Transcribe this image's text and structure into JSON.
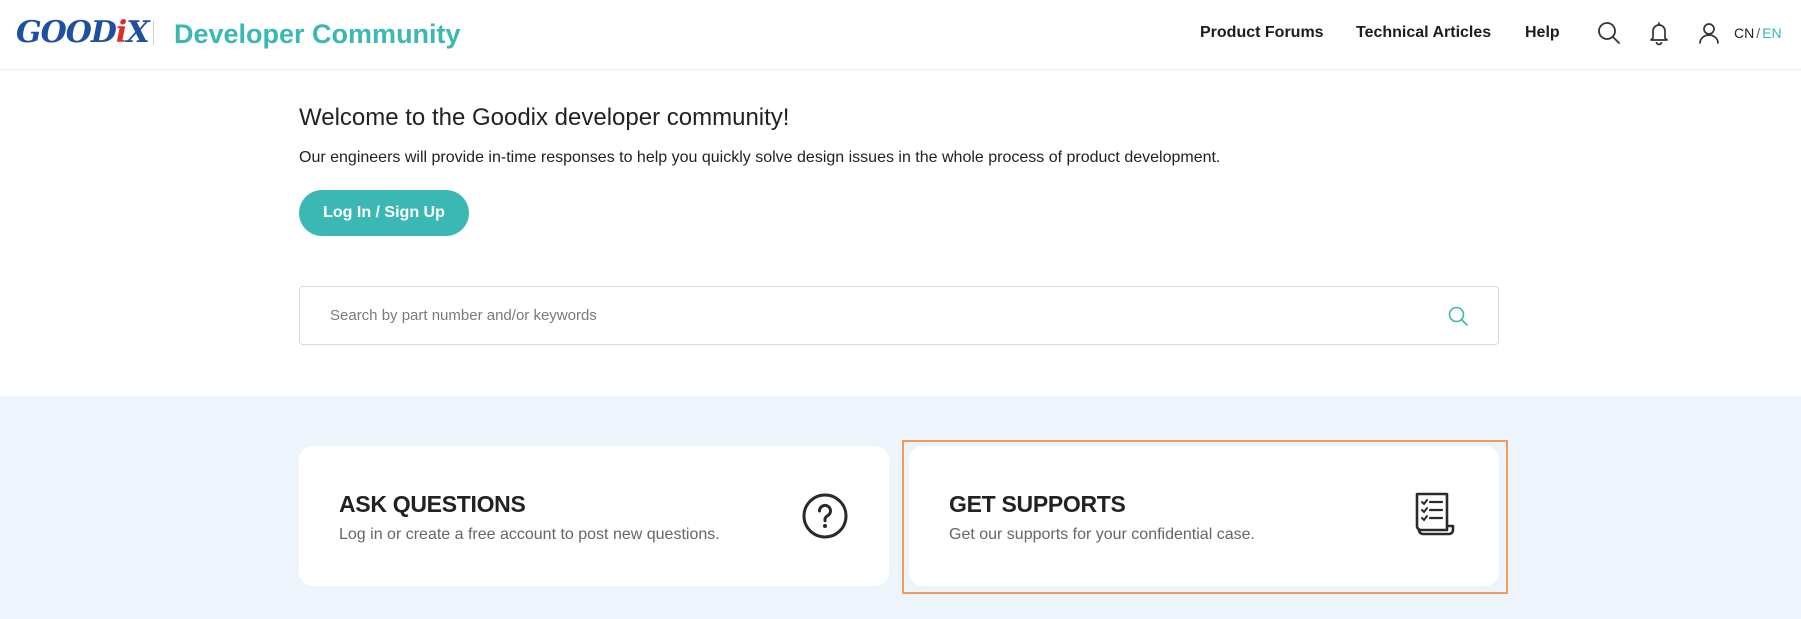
{
  "header": {
    "logo_text_a": "G",
    "logo_text_b": "OOD",
    "logo_text_c": "i",
    "logo_text_d": "X",
    "brand_title": "Developer Community",
    "nav": {
      "product_forums": "Product Forums",
      "technical_articles": "Technical Articles",
      "help": "Help"
    },
    "lang": {
      "cn": "CN",
      "sep": "/",
      "en": "EN"
    }
  },
  "hero": {
    "title": "Welcome to the Goodix developer community!",
    "description": "Our engineers will provide in-time responses to help you quickly solve design issues in the whole process of product development.",
    "login_button": "Log In / Sign Up",
    "search_placeholder": "Search by part number and/or keywords"
  },
  "cards": {
    "ask": {
      "title": "ASK QUESTIONS",
      "subtitle": "Log in or create a free account to post new questions.",
      "icon": "question-circle-icon"
    },
    "support": {
      "title": "GET SUPPORTS",
      "subtitle": "Get our supports for your confidential case.",
      "icon": "document-list-icon"
    }
  },
  "colors": {
    "accent": "#3bb8b3",
    "logo_blue": "#1f4fa0",
    "logo_red": "#e02b2b",
    "lower_bg": "#eef4fb",
    "highlight": "#f29a5c"
  }
}
